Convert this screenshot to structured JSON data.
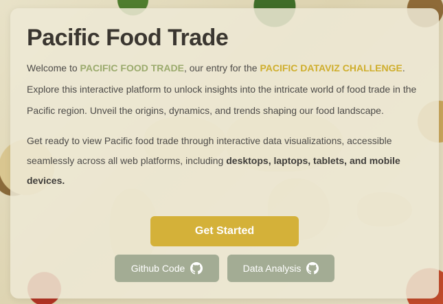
{
  "title": "Pacific Food Trade",
  "intro": {
    "t1": "Welcome to ",
    "brand": "PACIFIC FOOD TRADE",
    "t2": ", our entry for the ",
    "challenge": "PACIFIC DATAVIZ CHALLENGE",
    "t3": ". Explore this interactive platform to unlock insights into the intricate world of food trade in the Pacific region. Unveil the origins, dynamics, and trends shaping our food landscape."
  },
  "devices": {
    "t1": "Get ready to view Pacific food trade through interactive data visualizations, accessible seamlessly across all web platforms, including ",
    "strong": "desktops, laptops, tablets, and mobile devices."
  },
  "buttons": {
    "get_started": "Get Started",
    "github_code": "Github Code",
    "data_analysis": "Data Analysis"
  },
  "icons": {
    "github": "github-icon"
  },
  "colors": {
    "accent_gold": "#d4b139",
    "secondary_button": "#a3ac94",
    "highlight_green": "#9aaa6c",
    "highlight_gold": "#cfae2c"
  }
}
